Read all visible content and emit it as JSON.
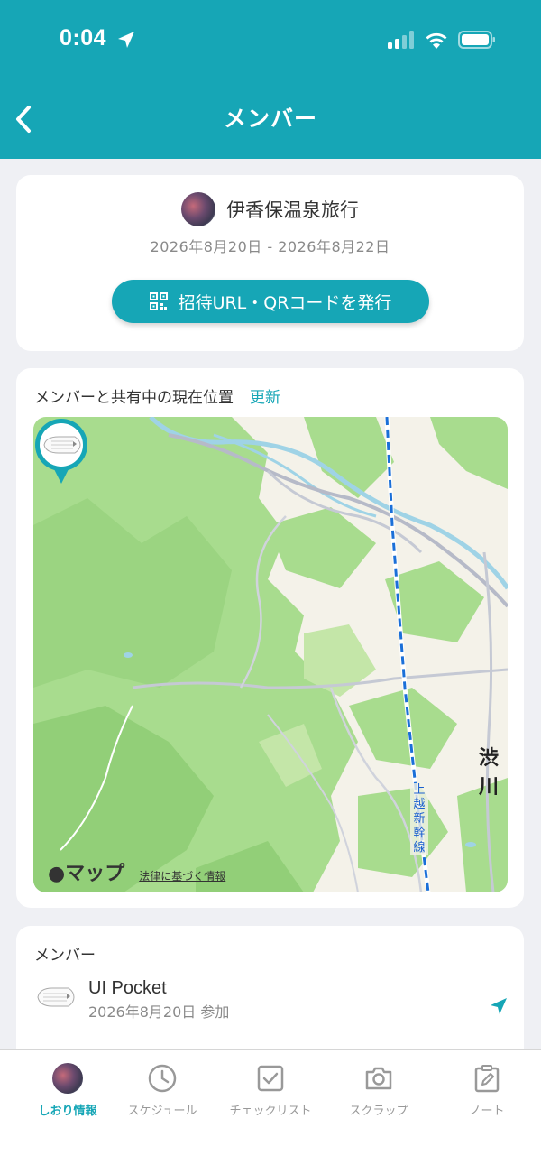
{
  "status_bar": {
    "time": "0:04"
  },
  "nav": {
    "title": "メンバー"
  },
  "trip": {
    "title": "伊香保温泉旅行",
    "dates": "2026年8月20日 - 2026年8月22日",
    "invite_button": "招待URL・QRコードを発行"
  },
  "location": {
    "header": "メンバーと共有中の現在位置",
    "refresh": "更新",
    "map_brand": "マップ",
    "map_legal": "法律に基づく情報",
    "map_place_label": "渋川",
    "rail_label": "上越新幹線"
  },
  "members": {
    "header": "メンバー",
    "items": [
      {
        "name": "UI Pocket",
        "joined": "2026年8月20日 参加"
      }
    ]
  },
  "tabs": [
    {
      "label": "しおり情報",
      "icon": "avatar",
      "active": true
    },
    {
      "label": "スケジュール",
      "icon": "clock-icon"
    },
    {
      "label": "チェックリスト",
      "icon": "checkbox-icon"
    },
    {
      "label": "スクラップ",
      "icon": "camera-icon"
    },
    {
      "label": "ノート",
      "icon": "note-icon"
    }
  ],
  "colors": {
    "accent": "#16a6b6",
    "background": "#eff0f4",
    "forest": "#a8dc8e"
  }
}
